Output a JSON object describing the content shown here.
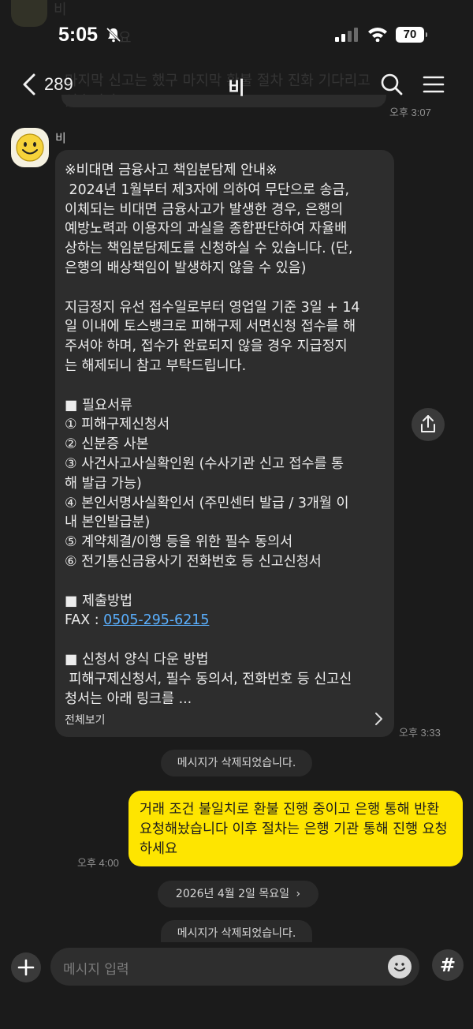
{
  "status_bar": {
    "time": "5:05",
    "battery": "70"
  },
  "background_ghost": {
    "sender": "비",
    "message_1": "요",
    "message_2": "마지막 신고는 했구 마지막 환불 절차 진화 기다리고 있습니다."
  },
  "header": {
    "back_count": "289",
    "title": "비"
  },
  "messages": {
    "prev_time": "오후 3:07",
    "sender_name": "비",
    "incoming_lines": [
      "※비대면 금융사고 책임분담제 안내※",
      " 2024년 1월부터 제3자에 의하여 무단으로 송금,",
      "이체되는 비대면 금융사고가 발생한 경우, 은행의",
      "예방노력과 이용자의 과실을 종합판단하여 자율배",
      "상하는 책임분담제도를 신청하실 수 있습니다. (단,",
      "은행의 배상책임이 발생하지 않을 수 있음)",
      "",
      "지급정지 유선 접수일로부터 영업일 기준 3일 + 14",
      "일 이내에 토스뱅크로 피해구제 서면신청 접수를 해",
      "주셔야 하며, 접수가 완료되지 않을 경우 지급정지",
      "는 해제되니 참고 부탁드립니다.",
      "",
      "■ 필요서류",
      "① 피해구제신청서",
      "② 신분증 사본",
      "③ 사건사고사실확인원 (수사기관 신고 접수를 통",
      "해 발급 가능)",
      "④ 본인서명사실확인서 (주민센터 발급 / 3개월 이",
      "내 본인발급분)",
      "⑤ 계약체결/이행 등을 위한 필수 동의서",
      "⑥ 전기통신금융사기 전화번호 등 신고신청서",
      "",
      "■ 제출방법",
      "FAX : ",
      "",
      "■ 신청서 양식 다운 방법",
      " 피해구제신청서, 필수 동의서, 전화번호 등 신고신",
      "청서는 아래 링크를 ..."
    ],
    "fax_number": "0505-295-6215",
    "view_all": "전체보기",
    "incoming_time": "오후 3:33",
    "deleted_1": "메시지가 삭제되었습니다.",
    "outgoing_text": "거래 조건 불일치로 환불 진행 중이고 은행 통해 반환 요청해놨습니다 이후 절차는 은행 기관 통해 진행 요청하세요",
    "outgoing_time": "오후 4:00",
    "date_divider": "2026년 4월 2일 목요일",
    "deleted_2": "메시지가 삭제되었습니다."
  },
  "composer": {
    "placeholder": "메시지 입력",
    "hash": "#"
  },
  "colors": {
    "background": "#1b1b1b",
    "incoming_bubble": "#2d2d2d",
    "outgoing_bubble": "#fee500",
    "link": "#5ab0ff"
  }
}
